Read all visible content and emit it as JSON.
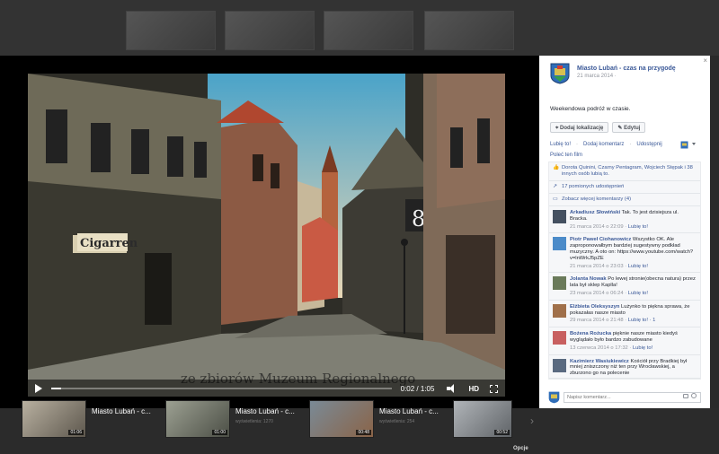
{
  "video": {
    "sign_text": "Cigarren",
    "house_number": "8",
    "watermark": "ze zbiorów Muzeum Regionalnego",
    "time": "0:02 / 1:05",
    "progress": 0.03,
    "hd_label": "HD"
  },
  "related": [
    {
      "title": "Miasto Lubań - c...",
      "duration": "01:06",
      "sub": ""
    },
    {
      "title": "Miasto Lubań - c...",
      "duration": "01:00",
      "sub": "wyświetlenia: 1270"
    },
    {
      "title": "Miasto Lubań - c...",
      "duration": "00:48",
      "sub": "wyświetlenia: 254"
    },
    {
      "title": "",
      "duration": "00:52",
      "sub": ""
    }
  ],
  "options_label": "Opcje",
  "panel": {
    "close": "×",
    "author": "Miasto Lubań - czas na przygodę",
    "date": "21 marca 2014 · ",
    "caption": "Weekendowa podróż w czasie.",
    "btn_location": "Dodaj lokalizację",
    "btn_edit": "Edytuj",
    "actions": [
      "Lubię to!",
      "Dodaj komentarz",
      "Udostępnij"
    ],
    "posted_in": "Poleć ten film",
    "likes_text": "Dorota Quinini, Czarny Pentagram, Wojciech Stępak i 38 innych osób lubią to.",
    "shares_text": "17 pomionych udostępnień",
    "more_comments": "Zobacz więcej komentarzy (4)",
    "comments": [
      {
        "name": "Arkadiusz Słowiński",
        "text": "Tak. To jest dzisiejsza ul. Bracka.",
        "meta": "21 marca 2014 o 22:09 · ",
        "like": "Lubię to!"
      },
      {
        "name": "Piotr Paweł Ciohanowicz",
        "text": "Wszystko OK. Ale zaproponowałbym bardziej sugestywny podkład muzyczny. A oto on: https://www.youtube.com/watch?v=lnWrkJ5pZE",
        "meta": "21 marca 2014 o 23:03 · ",
        "like": "Lubię to!"
      },
      {
        "name": "Jolanta Nowak",
        "text": "Po lewej stronie(obecna natura) przez lata był sklep Kaplla!",
        "meta": "23 marca 2014 o 06:24 · ",
        "like": "Lubię to!"
      },
      {
        "name": "Elżbieta Oleksyszyn",
        "text": "Lużynko to piękna sprawa, że pokazałas nasze miasto",
        "meta": "29 marca 2014 o 21:48 · ",
        "like": "Lubię to! · 1"
      },
      {
        "name": "Bożena Rożucka",
        "text": "pięknie nasze miasto kiedyś wyglądało było bardzo zabudowane",
        "meta": "13 czerwca 2014 o 17:32 · ",
        "like": "Lubię to!"
      },
      {
        "name": "Kazimierz Wasiukiewicz",
        "text": "Kościół przy Bradkiej był mniej zniszczony niż ten przy Wrocławskiej, a zburzono go na polecenie",
        "meta": "",
        "like": ""
      }
    ],
    "composer_placeholder": "Napisz komentarz..."
  },
  "colors": {
    "link": "#3b5998",
    "meta": "#90949c"
  }
}
